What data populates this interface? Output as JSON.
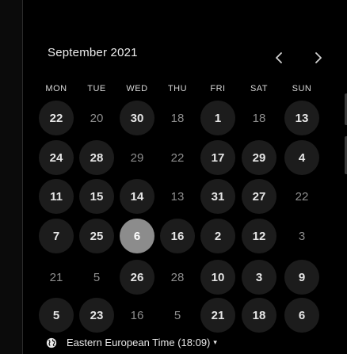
{
  "calendar": {
    "month_label": "September 2021",
    "prev_icon": "chevron-left-icon",
    "next_icon": "chevron-right-icon",
    "weekdays": [
      "MON",
      "TUE",
      "WED",
      "THU",
      "FRI",
      "SAT",
      "SUN"
    ],
    "weeks": [
      [
        {
          "d": "22",
          "s": "avail"
        },
        {
          "d": "20",
          "s": "muted"
        },
        {
          "d": "30",
          "s": "avail"
        },
        {
          "d": "18",
          "s": "muted"
        },
        {
          "d": "1",
          "s": "avail"
        },
        {
          "d": "18",
          "s": "muted"
        },
        {
          "d": "13",
          "s": "avail"
        }
      ],
      [
        {
          "d": "24",
          "s": "avail"
        },
        {
          "d": "28",
          "s": "avail"
        },
        {
          "d": "29",
          "s": "muted"
        },
        {
          "d": "22",
          "s": "muted"
        },
        {
          "d": "17",
          "s": "avail"
        },
        {
          "d": "29",
          "s": "avail"
        },
        {
          "d": "4",
          "s": "avail"
        }
      ],
      [
        {
          "d": "11",
          "s": "avail"
        },
        {
          "d": "15",
          "s": "avail"
        },
        {
          "d": "14",
          "s": "avail"
        },
        {
          "d": "13",
          "s": "muted"
        },
        {
          "d": "31",
          "s": "avail"
        },
        {
          "d": "27",
          "s": "avail"
        },
        {
          "d": "22",
          "s": "muted"
        }
      ],
      [
        {
          "d": "7",
          "s": "avail"
        },
        {
          "d": "25",
          "s": "avail"
        },
        {
          "d": "6",
          "s": "selected"
        },
        {
          "d": "16",
          "s": "avail"
        },
        {
          "d": "2",
          "s": "avail"
        },
        {
          "d": "12",
          "s": "avail"
        },
        {
          "d": "3",
          "s": "muted"
        }
      ],
      [
        {
          "d": "21",
          "s": "muted"
        },
        {
          "d": "5",
          "s": "muted"
        },
        {
          "d": "26",
          "s": "avail"
        },
        {
          "d": "28",
          "s": "muted"
        },
        {
          "d": "10",
          "s": "avail"
        },
        {
          "d": "3",
          "s": "avail"
        },
        {
          "d": "9",
          "s": "avail"
        }
      ],
      [
        {
          "d": "5",
          "s": "avail"
        },
        {
          "d": "23",
          "s": "avail"
        },
        {
          "d": "16",
          "s": "muted"
        },
        {
          "d": "5",
          "s": "muted"
        },
        {
          "d": "21",
          "s": "avail"
        },
        {
          "d": "18",
          "s": "avail"
        },
        {
          "d": "6",
          "s": "avail"
        }
      ]
    ]
  },
  "timezone": {
    "icon": "globe-icon",
    "label": "Eastern European Time (18:09)",
    "caret_icon": "caret-down-icon",
    "caret": "▾"
  },
  "colors": {
    "background": "#000000",
    "available_day": "#1c1c1c",
    "selected_day": "#8c8c8c",
    "muted_text": "#8e8e8e"
  }
}
